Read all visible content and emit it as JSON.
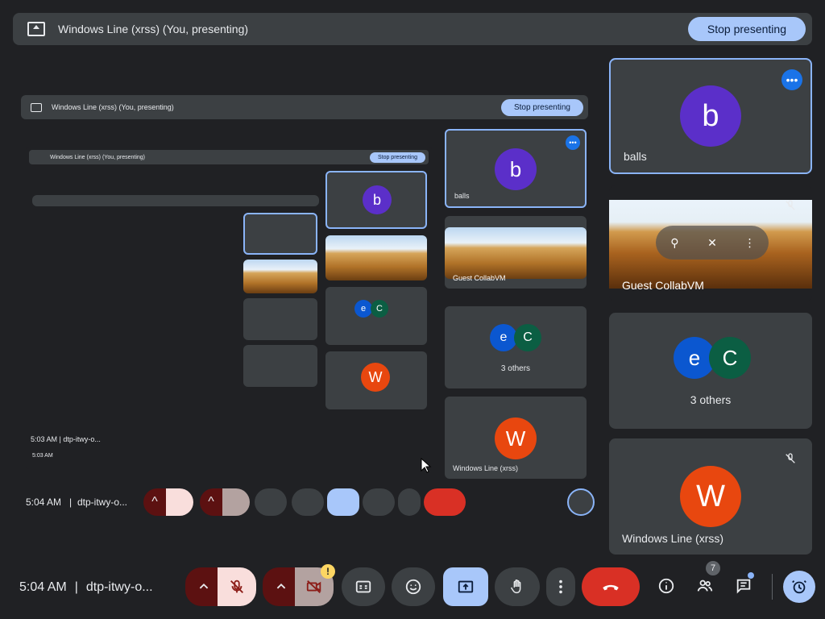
{
  "banner": {
    "title": "Windows Line (xrss) (You, presenting)",
    "stop_label": "Stop presenting"
  },
  "mirror": {
    "title": "Windows Line (xrss) (You, presenting)",
    "stop_label": "Stop presenting",
    "nested_title": "Windows Line (xrss) (You, presenting)",
    "nested_stop": "Stop presenting",
    "time": "5:04 AM",
    "code": "dtp-itwy-o...",
    "inner_time": "5:03 AM",
    "inner_code": "dtp-itwy-o..."
  },
  "participants": [
    {
      "name": "balls",
      "initial": "b",
      "color": "#5b2fc9"
    },
    {
      "name": "Guest CollabVM"
    },
    {
      "name": "3 others",
      "initials": [
        "e",
        "C"
      ],
      "colors": [
        "#0b57d0",
        "#0b5e43"
      ]
    },
    {
      "name": "Windows Line (xrss)",
      "initial": "W",
      "color": "#e8470f"
    }
  ],
  "bottombar": {
    "time": "5:04 AM",
    "separator": "|",
    "meeting_code": "dtp-itwy-o...",
    "people_count": "7",
    "cam_warning": "!"
  },
  "icons": {
    "mic": "mic-off-icon",
    "cam": "camera-off-icon",
    "captions": "captions-icon",
    "emoji": "emoji-icon",
    "present": "present-icon",
    "hand": "raise-hand-icon",
    "more": "more-vert-icon",
    "leave": "end-call-icon",
    "info": "info-icon",
    "people": "people-icon",
    "chat": "chat-icon",
    "activities": "activities-icon"
  }
}
